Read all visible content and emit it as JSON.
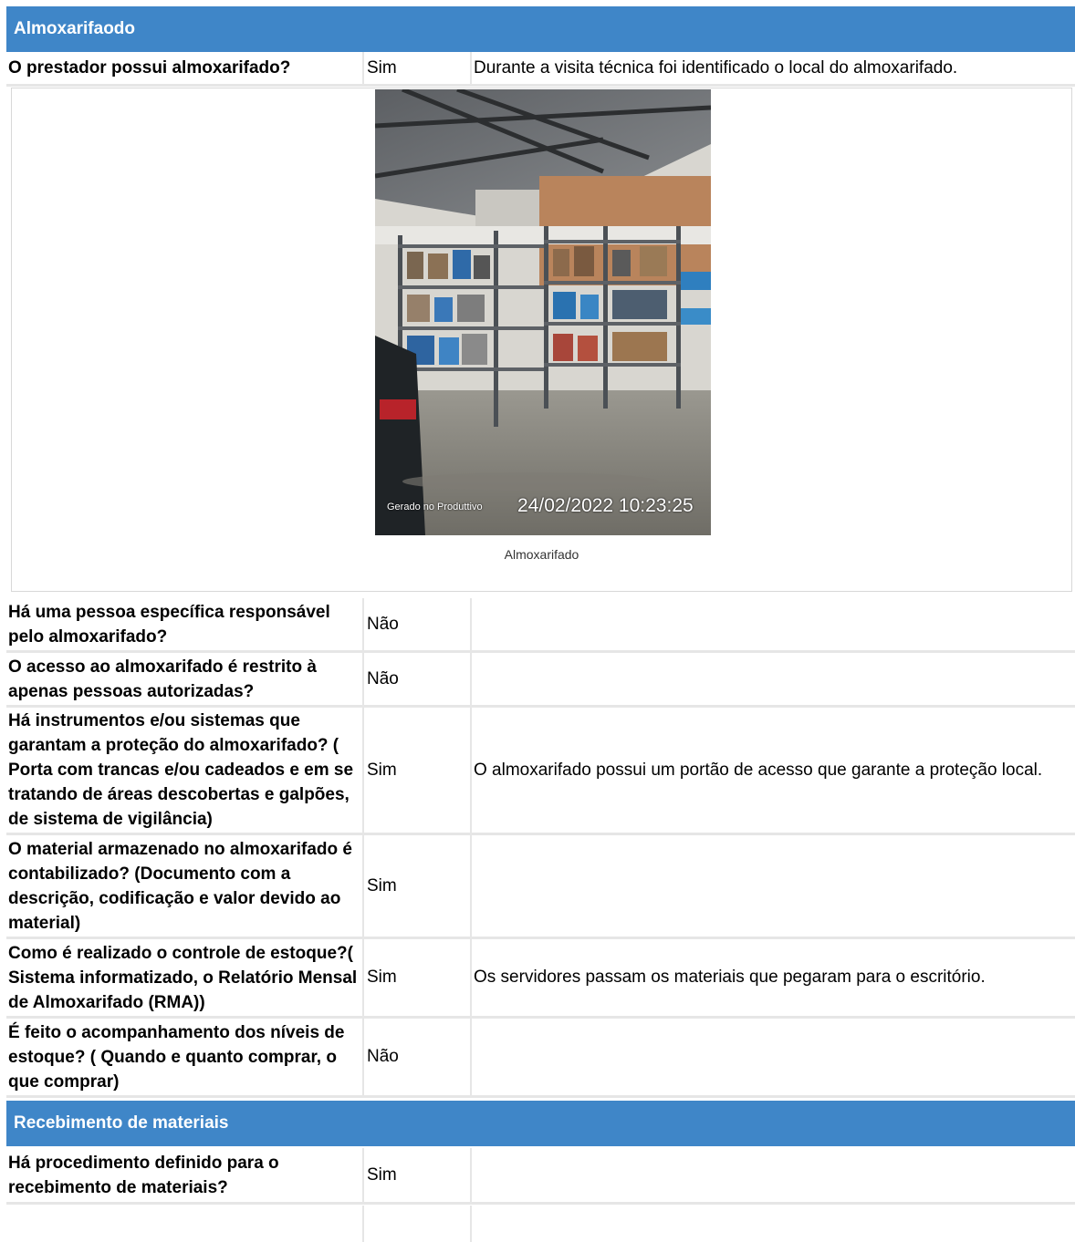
{
  "sections": {
    "almox": {
      "title": "Almoxarifaodo"
    },
    "receb": {
      "title": "Recebimento de materiais"
    }
  },
  "rows": [
    {
      "question": "O prestador possui almoxarifado?",
      "answer": "Sim",
      "comment": "Durante a visita técnica foi identificado o local do almoxarifado."
    },
    {
      "question": "Há uma pessoa específica responsável pelo almoxarifado?",
      "answer": "Não",
      "comment": ""
    },
    {
      "question": "O acesso ao almoxarifado é restrito à apenas pessoas autorizadas?",
      "answer": "Não",
      "comment": ""
    },
    {
      "question": "Há instrumentos e/ou sistemas que garantam a proteção do almoxarifado? ( Porta com trancas e/ou cadeados e em se tratando de áreas descobertas e galpões, de sistema de vigilância)",
      "answer": "Sim",
      "comment": "O almoxarifado possui um portão de acesso que garante a proteção local."
    },
    {
      "question": "O material armazenado no almoxarifado é contabilizado? (Documento com a descrição, codificação e valor devido ao material)",
      "answer": "Sim",
      "comment": ""
    },
    {
      "question": "Como é realizado o controle de estoque?( Sistema informatizado, o Relatório Mensal de Almoxarifado (RMA))",
      "answer": "Sim",
      "comment": "Os servidores passam os materiais que pegaram para o escritório."
    },
    {
      "question": "É feito o acompanhamento dos níveis de estoque? ( Quando e quanto comprar, o que comprar)",
      "answer": "Não",
      "comment": ""
    },
    {
      "question": "Há procedimento definido para o recebimento de materiais?",
      "answer": "Sim",
      "comment": ""
    }
  ],
  "photo": {
    "stamp_app": "Gerado no Produttivo",
    "stamp_datetime": "24/02/2022 10:23:25",
    "caption": "Almoxarifado"
  },
  "colors": {
    "header": "#3f86c8",
    "divider": "#e6e6e6"
  }
}
